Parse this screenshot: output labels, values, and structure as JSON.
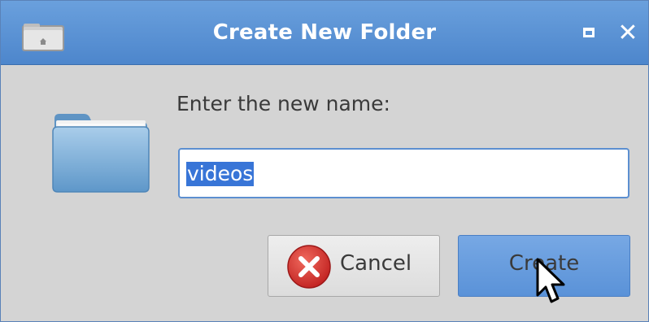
{
  "window": {
    "title": "Create New Folder",
    "title_icon": "folder-icon",
    "controls": {
      "maximize": "maximize-icon",
      "close_symbol": "✕"
    }
  },
  "dialog": {
    "prompt": "Enter the new name:",
    "icon": "folder-icon",
    "name_field": {
      "value": "videos",
      "selected": true
    }
  },
  "buttons": {
    "cancel": {
      "label": "Cancel",
      "icon": "cancel-icon"
    },
    "create": {
      "label": "Create",
      "is_default": true
    }
  },
  "colors": {
    "titlebar": "#5b93d5",
    "selection": "#3875d7",
    "default_button": "#6aa0de",
    "cancel_icon": "#d9302f"
  }
}
